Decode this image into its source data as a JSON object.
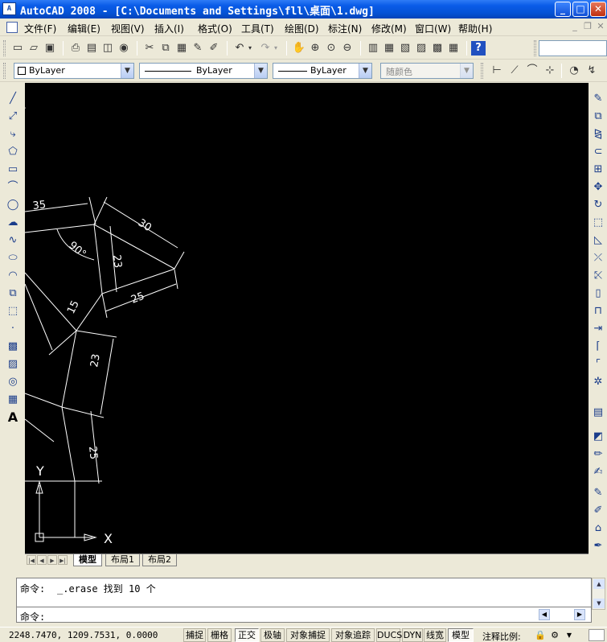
{
  "window": {
    "app_icon_text": "A",
    "title": "AutoCAD 2008 - [C:\\Documents and Settings\\fll\\桌面\\1.dwg]",
    "minimize": "_",
    "maximize": "□",
    "close": "✕"
  },
  "menu": {
    "items": [
      "文件(F)",
      "编辑(E)",
      "视图(V)",
      "插入(I)",
      "格式(O)",
      "工具(T)",
      "绘图(D)",
      "标注(N)",
      "修改(M)",
      "窗口(W)",
      "帮助(H)"
    ],
    "mdi_minimize": "_",
    "mdi_restore": "❐",
    "mdi_close": "✕"
  },
  "toolbar_standard": {
    "icons": [
      "new-icon",
      "open-icon",
      "save-icon",
      "plot-icon",
      "preview-icon",
      "publish-icon",
      "etransmit-icon",
      "cut-icon",
      "copy-icon",
      "paste-icon",
      "matchprop-icon",
      "blockeditor-icon",
      "undo-icon",
      "redo-icon",
      "pan-icon",
      "zoom-realtime-icon",
      "zoom-window-icon",
      "zoom-previous-icon",
      "properties-icon",
      "designcenter-icon",
      "toolpalettes-icon",
      "sheetset-icon",
      "markup-icon",
      "calculator-icon",
      "help-icon"
    ]
  },
  "toolbar_properties": {
    "layer_color": "ByLayer",
    "linetype": "ByLayer",
    "lineweight": "ByLayer",
    "plotstyle": "随颜色"
  },
  "draw_toolbar": {
    "icons": [
      "line-icon",
      "xline-icon",
      "polyline-icon",
      "polygon-icon",
      "rectangle-icon",
      "arc-icon",
      "circle-icon",
      "revcloud-icon",
      "spline-icon",
      "ellipse-icon",
      "ellipse-arc-icon",
      "insert-block-icon",
      "make-block-icon",
      "point-icon",
      "hatch-icon",
      "gradient-icon",
      "region-icon",
      "table-icon",
      "mtext-icon"
    ],
    "mtext_glyph": "A"
  },
  "modify_toolbar": {
    "icons": [
      "erase-icon",
      "copy-object-icon",
      "mirror-icon",
      "offset-icon",
      "array-icon",
      "move-icon",
      "rotate-icon",
      "scale-icon",
      "stretch-icon",
      "trim-icon",
      "extend-icon",
      "break-point-icon",
      "break-icon",
      "join-icon",
      "chamfer-icon",
      "fillet-icon",
      "explode-icon"
    ]
  },
  "drawing": {
    "dimensions": {
      "d35": "35",
      "d30": "30",
      "d90": "90°",
      "d23a": "23",
      "d25a": "25",
      "d15": "15",
      "d23b": "23",
      "d25b": "25"
    },
    "ucs": {
      "x_label": "X",
      "y_label": "Y"
    }
  },
  "layout_tabs": {
    "nav": [
      "|◀",
      "◀",
      "▶",
      "▶|"
    ],
    "tabs": [
      "模型",
      "布局1",
      "布局2"
    ],
    "active": "模型"
  },
  "command": {
    "history_prompt": "命令:",
    "history_text": "_.erase 找到 10 个",
    "input_prompt": "命令:"
  },
  "status": {
    "coordinates": "2248.7470, 1209.7531, 0.0000",
    "toggles": [
      {
        "label": "捕捉",
        "on": false
      },
      {
        "label": "栅格",
        "on": false
      },
      {
        "label": "正交",
        "on": true
      },
      {
        "label": "极轴",
        "on": false
      },
      {
        "label": "对象捕捉",
        "on": false
      },
      {
        "label": "对象追踪",
        "on": false
      },
      {
        "label": "DUCS",
        "on": false
      },
      {
        "label": "DYN",
        "on": false
      },
      {
        "label": "线宽",
        "on": false
      }
    ],
    "model_label": "模型",
    "annotation_scale_label": "注释比例:"
  }
}
